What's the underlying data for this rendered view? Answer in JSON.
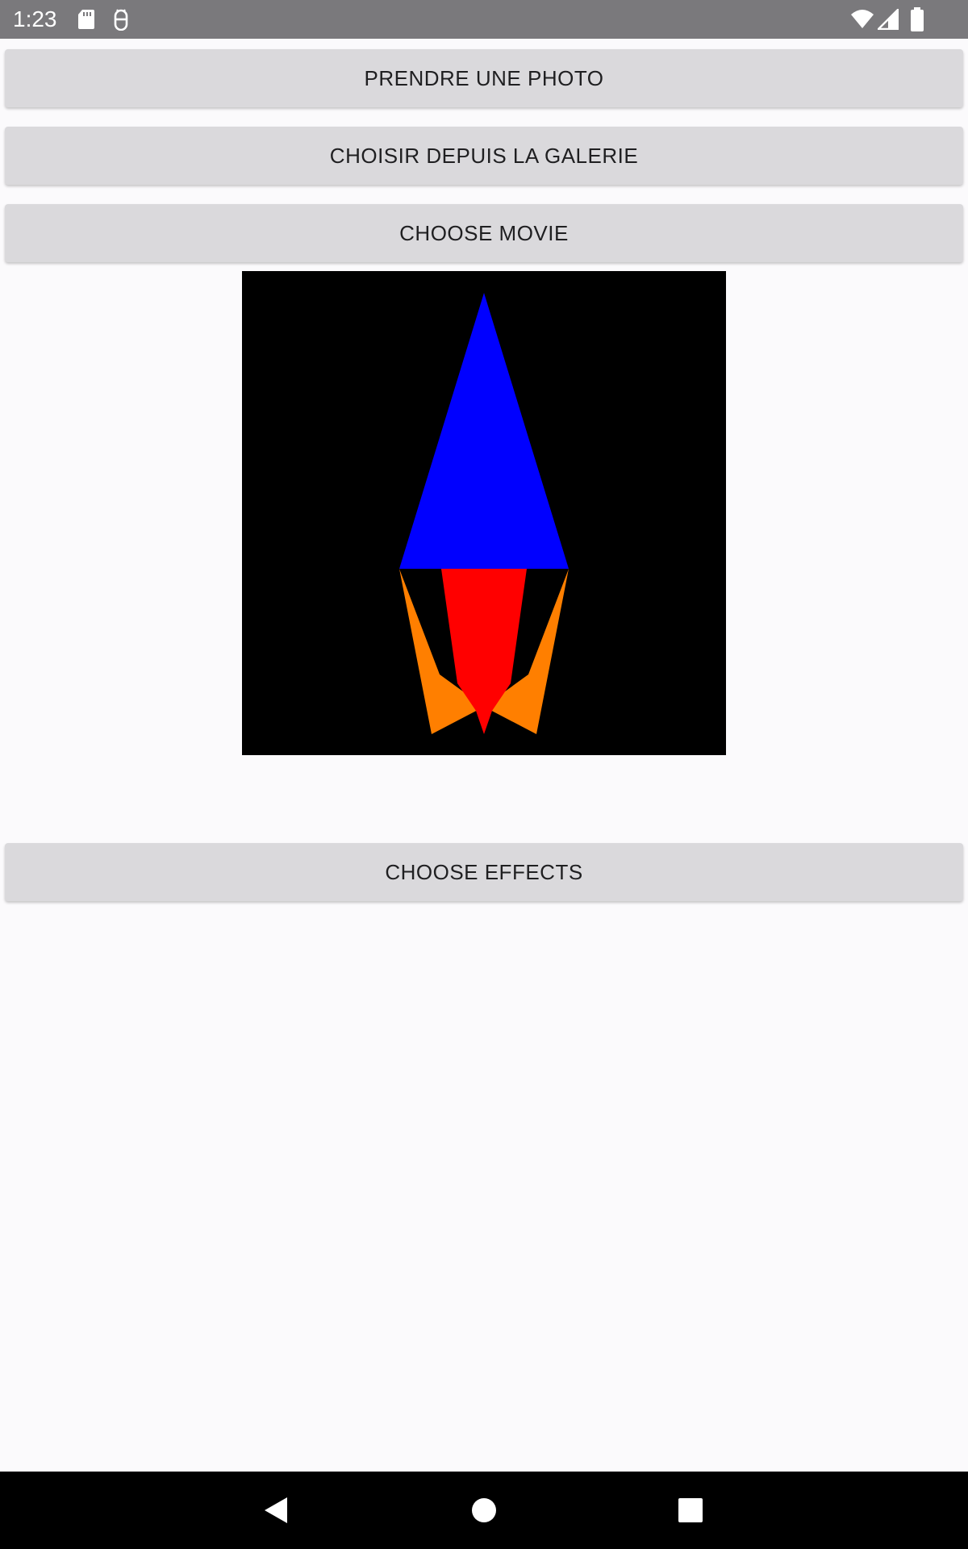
{
  "status_bar": {
    "time": "1:23",
    "icons": [
      "sd-card-icon",
      "android-debug-icon",
      "wifi-icon",
      "cellular-signal-icon",
      "battery-icon"
    ]
  },
  "buttons": {
    "take_photo": "PRENDRE UNE PHOTO",
    "choose_gallery": "CHOISIR DEPUIS LA GALERIE",
    "choose_movie": "CHOOSE MOVIE",
    "choose_effects": "CHOOSE EFFECTS"
  },
  "preview": {
    "colors": {
      "background": "#000000",
      "nose": "#0000ff",
      "body": "#ff0000",
      "fins": "#ff7f00"
    }
  },
  "nav_bar": {
    "icons": [
      "back-icon",
      "home-icon",
      "recents-icon"
    ]
  },
  "colors": {
    "status_bar": "#7a797c",
    "button_bg": "#dad9dc",
    "screen_bg": "#fbfafc"
  }
}
